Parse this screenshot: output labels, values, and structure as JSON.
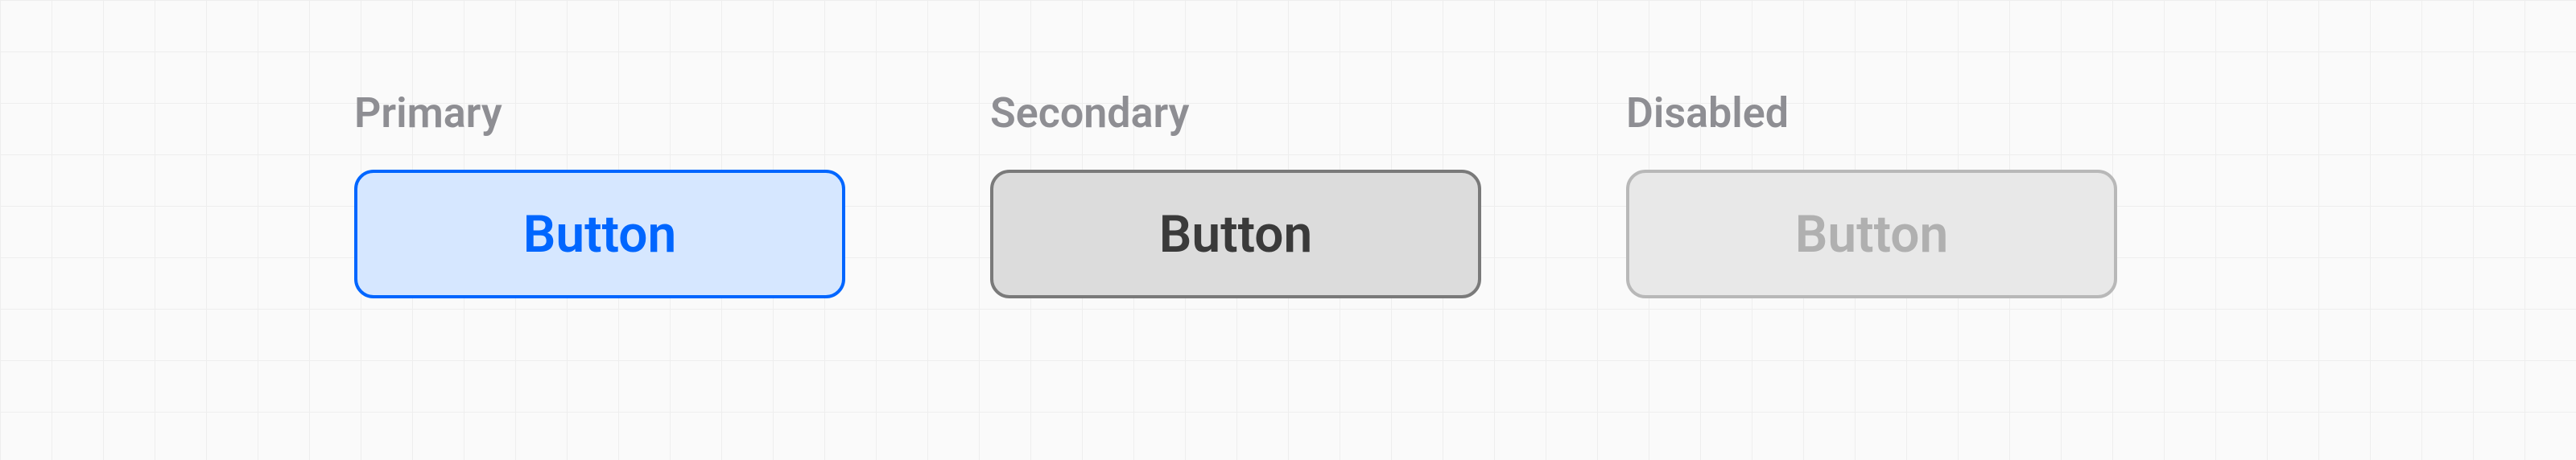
{
  "variants": {
    "primary": {
      "title": "Primary",
      "label": "Button"
    },
    "secondary": {
      "title": "Secondary",
      "label": "Button"
    },
    "disabled": {
      "title": "Disabled",
      "label": "Button"
    }
  }
}
